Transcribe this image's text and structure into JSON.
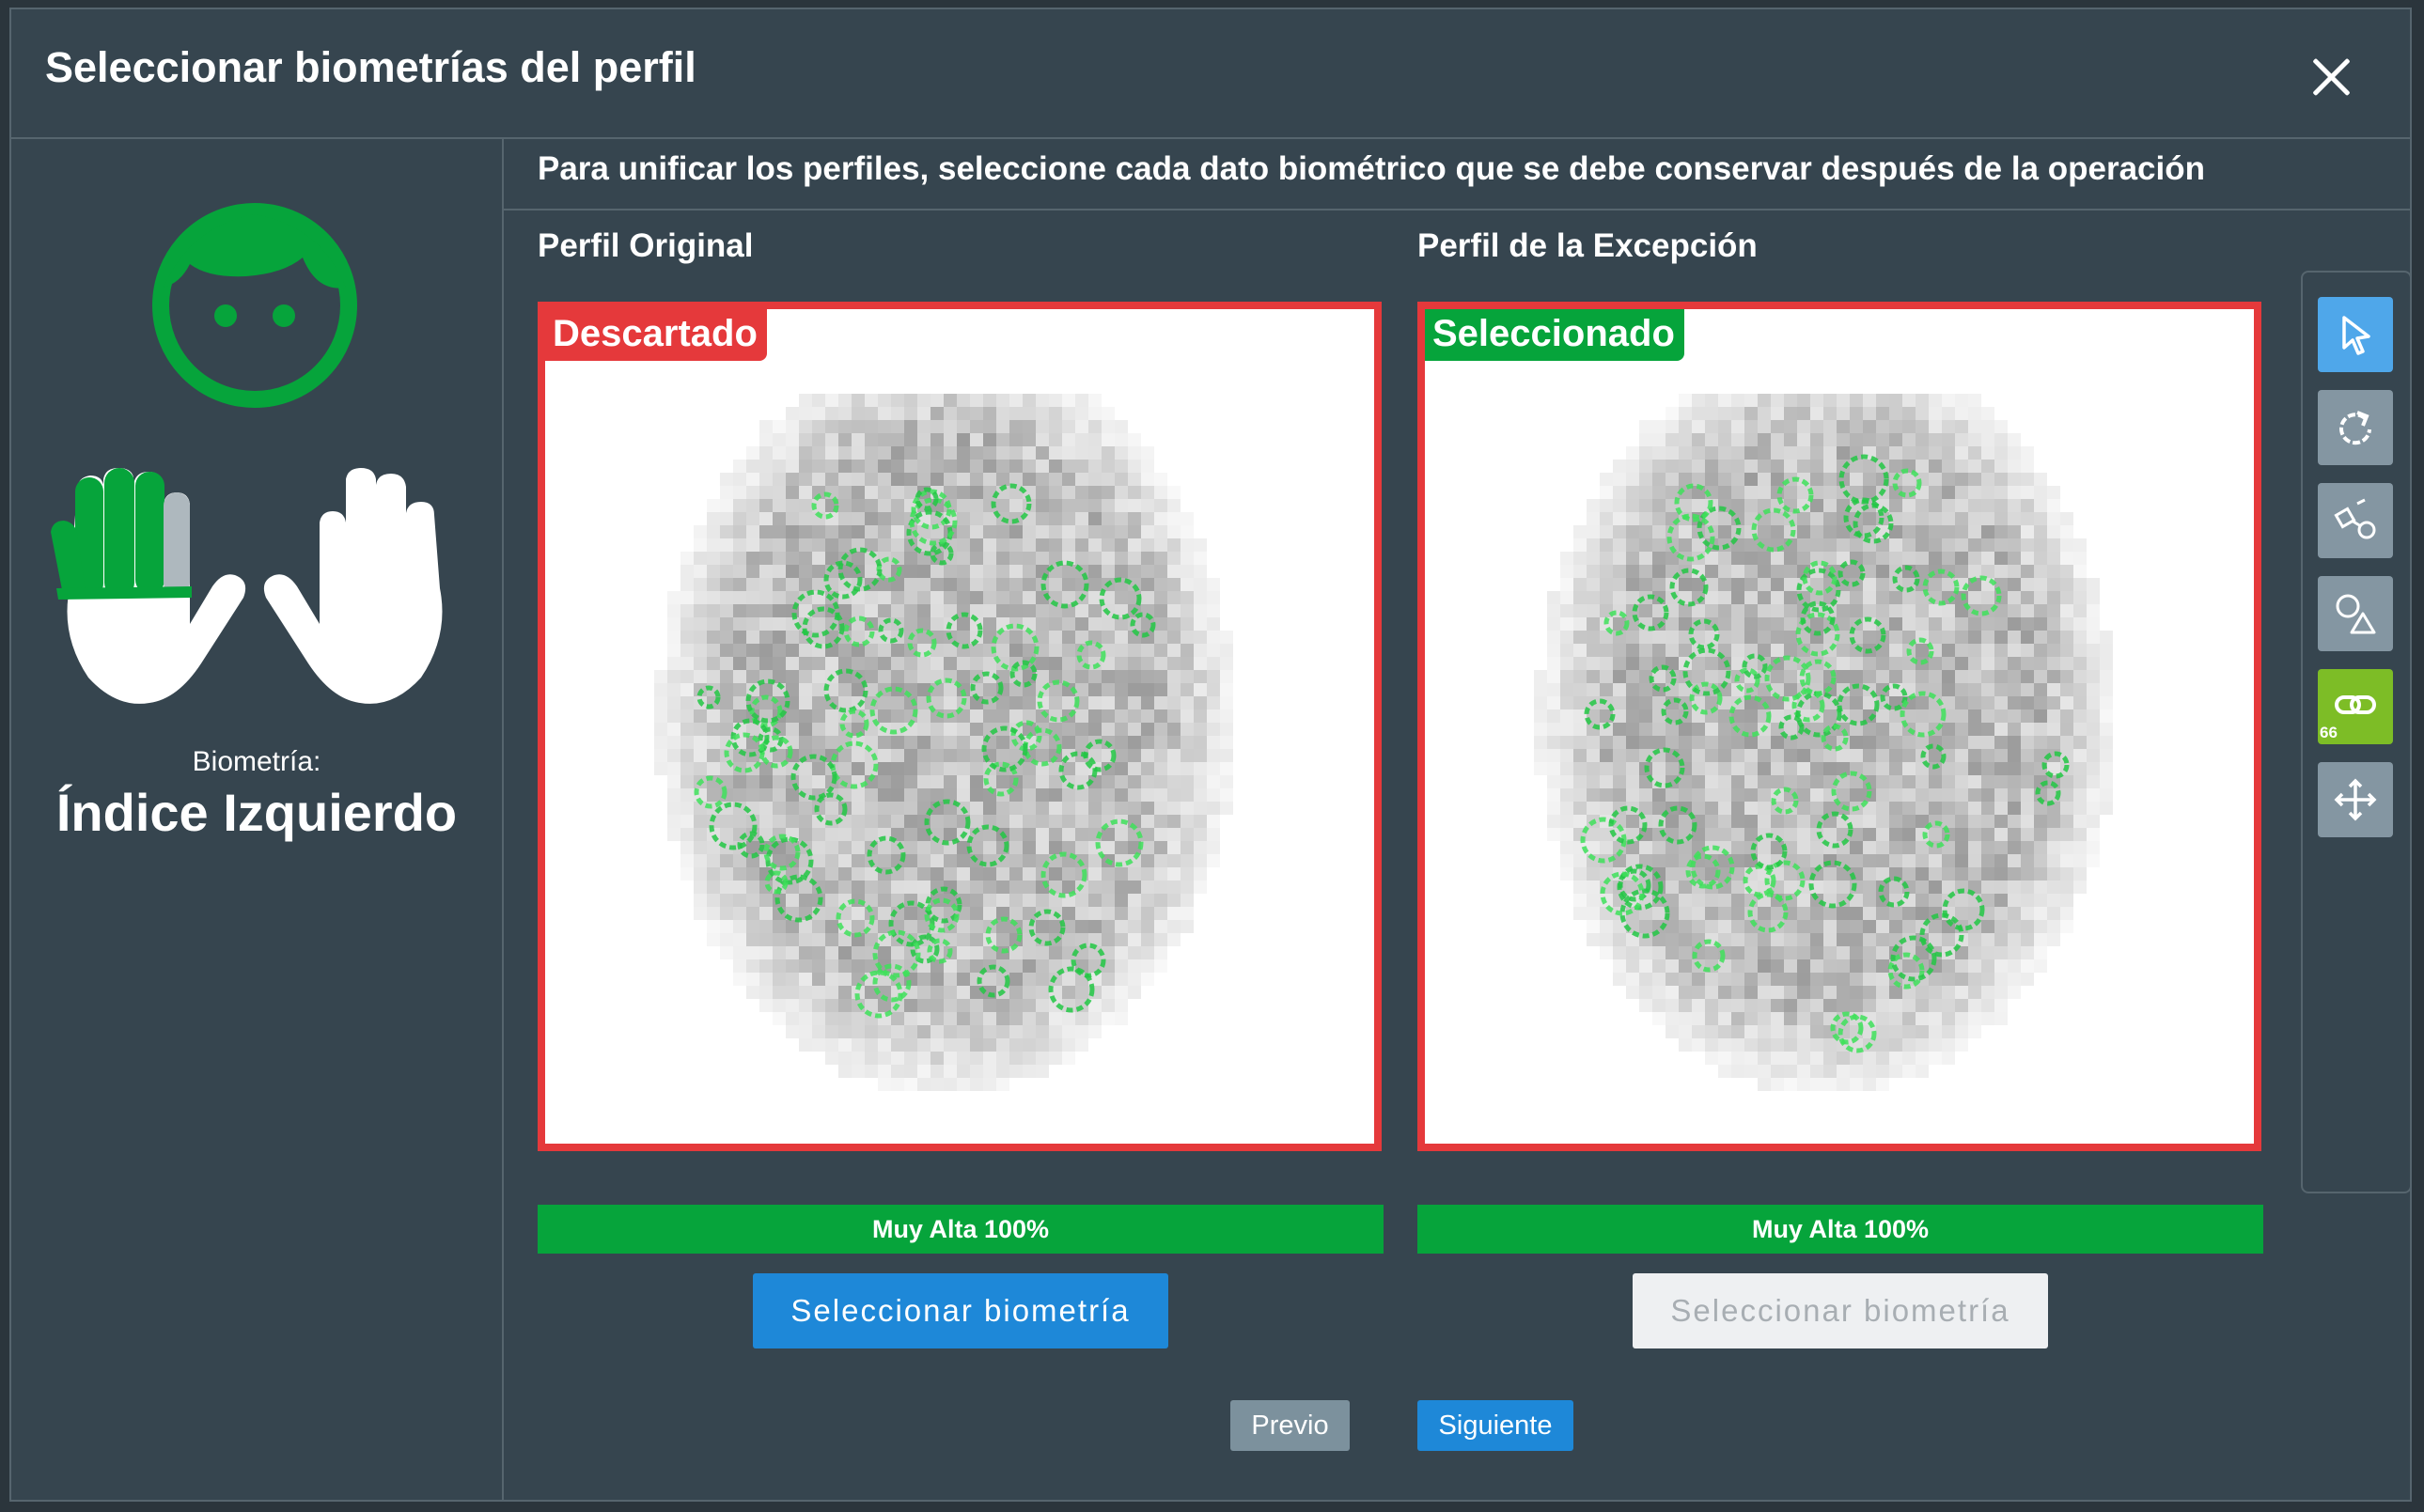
{
  "dialog": {
    "title": "Seleccionar biometrías del perfil",
    "instruction": "Para unificar los perfiles, seleccione cada dato biométrico que se debe conservar después de la operación"
  },
  "biometric": {
    "label": "Biometría:",
    "value": "Índice Izquierdo"
  },
  "profiles": [
    {
      "title": "Perfil Original",
      "status": "Descartado",
      "status_color": "#e5393b",
      "quality": "Muy Alta 100%",
      "button_label": "Seleccionar biometría",
      "button_enabled": true
    },
    {
      "title": "Perfil de la Excepción",
      "status": "Seleccionado",
      "status_color": "#06a43b",
      "quality": "Muy Alta 100%",
      "button_label": "Seleccionar biometría",
      "button_enabled": false
    }
  ],
  "nav": {
    "prev_label": "Previo",
    "next_label": "Siguiente"
  },
  "toolbar": {
    "tools": [
      {
        "name": "pointer-tool",
        "icon": "cursor-arrow-icon",
        "selected": true
      },
      {
        "name": "rotate-tool",
        "icon": "rotate-icon",
        "selected": false
      },
      {
        "name": "draw-tool",
        "icon": "draw-shapes-icon",
        "selected": false
      },
      {
        "name": "shapes-tool",
        "icon": "shapes-icon",
        "selected": false
      },
      {
        "name": "link-tool",
        "icon": "link-icon",
        "selected": false
      },
      {
        "name": "move-tool",
        "icon": "move-icon",
        "selected": false
      }
    ],
    "link_count": "66"
  },
  "colors": {
    "accent": "#1e88d8",
    "success": "#06a43b",
    "danger": "#e5393b",
    "background": "#36454f"
  }
}
